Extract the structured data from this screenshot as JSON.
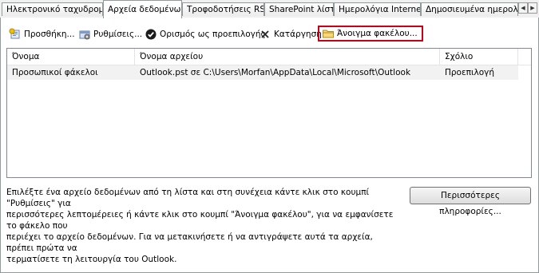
{
  "tabs": [
    {
      "label": "Ηλεκτρονικό ταχυδρομείο",
      "active": false
    },
    {
      "label": "Αρχεία δεδομένων",
      "active": true
    },
    {
      "label": "Τροφοδοτήσεις RSS",
      "active": false
    },
    {
      "label": "SharePoint λίστες",
      "active": false
    },
    {
      "label": "Ημερολόγια Internet",
      "active": false
    },
    {
      "label": "Δημοσιευμένα ημερολόγια",
      "active": false
    }
  ],
  "tab_scroll": {
    "left": "◀",
    "right": "▶"
  },
  "toolbar": {
    "add_label": "Προσθήκη...",
    "settings_label": "Ρυθμίσεις...",
    "set_default_label": "Ορισμός ως προεπιλογής",
    "remove_label": "Κατάργηση",
    "open_folder_label": "Άνοιγμα φακέλου..."
  },
  "list": {
    "columns": [
      "Όνομα",
      "Όνομα αρχείου",
      "Σχόλιο"
    ],
    "rows": [
      {
        "name": "Προσωπικοί φάκελοι",
        "file": "Outlook.pst σε C:\\Users\\Morfan\\AppData\\Local\\Microsoft\\Outlook",
        "comment": "Προεπιλογή"
      }
    ]
  },
  "description": {
    "line1": "Επιλέξτε ένα αρχείο δεδομένων από τη λίστα και στη συνέχεια κάντε κλικ στο κουμπί \"Ρυθμίσεις\" για",
    "line2": "περισσότερες λεπτομέρειες ή κάντε κλικ στο κουμπί \"Άνοιγμα φακέλου\", για να εμφανίσετε το φάκελο που",
    "line3": "περιέχει το αρχείο δεδομένων. Για να μετακινήσετε ή να αντιγράψετε αυτά τα αρχεία, πρέπει πρώτα να",
    "line4": "τερματίσετε τη λειτουργία του Outlook."
  },
  "more_info_label": "Περισσότερες πληροφορίες..."
}
